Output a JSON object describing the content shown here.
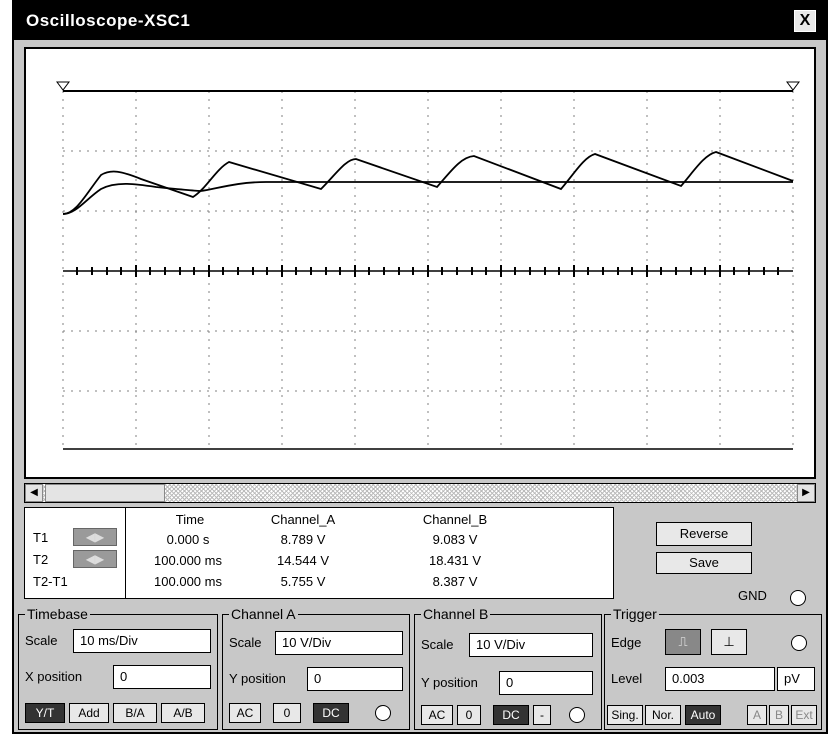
{
  "window": {
    "title": "Oscilloscope-XSC1",
    "close_label": "X"
  },
  "icons": {
    "close": "close-icon",
    "left_arrow": "arrow-left-icon",
    "right_arrow": "arrow-right-icon"
  },
  "readout": {
    "headers": [
      "Time",
      "Channel_A",
      "Channel_B"
    ],
    "rows": [
      {
        "label": "T1",
        "time": "0.000 s",
        "a": "8.789 V",
        "b": "9.083 V"
      },
      {
        "label": "T2",
        "time": "100.000 ms",
        "a": "14.544 V",
        "b": "18.431 V"
      },
      {
        "label": "T2-T1",
        "time": "100.000 ms",
        "a": "5.755 V",
        "b": "8.387 V"
      }
    ]
  },
  "buttons": {
    "reverse": "Reverse",
    "save": "Save"
  },
  "gnd_label": "GND",
  "timebase": {
    "title": "Timebase",
    "scale_label": "Scale",
    "scale_value": "10 ms/Div",
    "xpos_label": "X position",
    "xpos_value": "0",
    "modes": [
      "Y/T",
      "Add",
      "B/A",
      "A/B"
    ]
  },
  "channel_a": {
    "title": "Channel A",
    "scale_label": "Scale",
    "scale_value": "10  V/Div",
    "ypos_label": "Y position",
    "ypos_value": "0",
    "coupling": [
      "AC",
      "0",
      "DC"
    ]
  },
  "channel_b": {
    "title": "Channel B",
    "scale_label": "Scale",
    "scale_value": "10  V/Div",
    "ypos_label": "Y position",
    "ypos_value": "0",
    "coupling": [
      "AC",
      "0",
      "DC",
      "-"
    ]
  },
  "trigger": {
    "title": "Trigger",
    "edge_label": "Edge",
    "level_label": "Level",
    "level_value": "0.003",
    "level_unit": "pV",
    "modes": [
      "Sing.",
      "Nor.",
      "Auto",
      "A",
      "B",
      "Ext"
    ]
  },
  "colors": {
    "trace": "#000000",
    "grid": "#808080",
    "screen_bg": "#ffffff"
  }
}
